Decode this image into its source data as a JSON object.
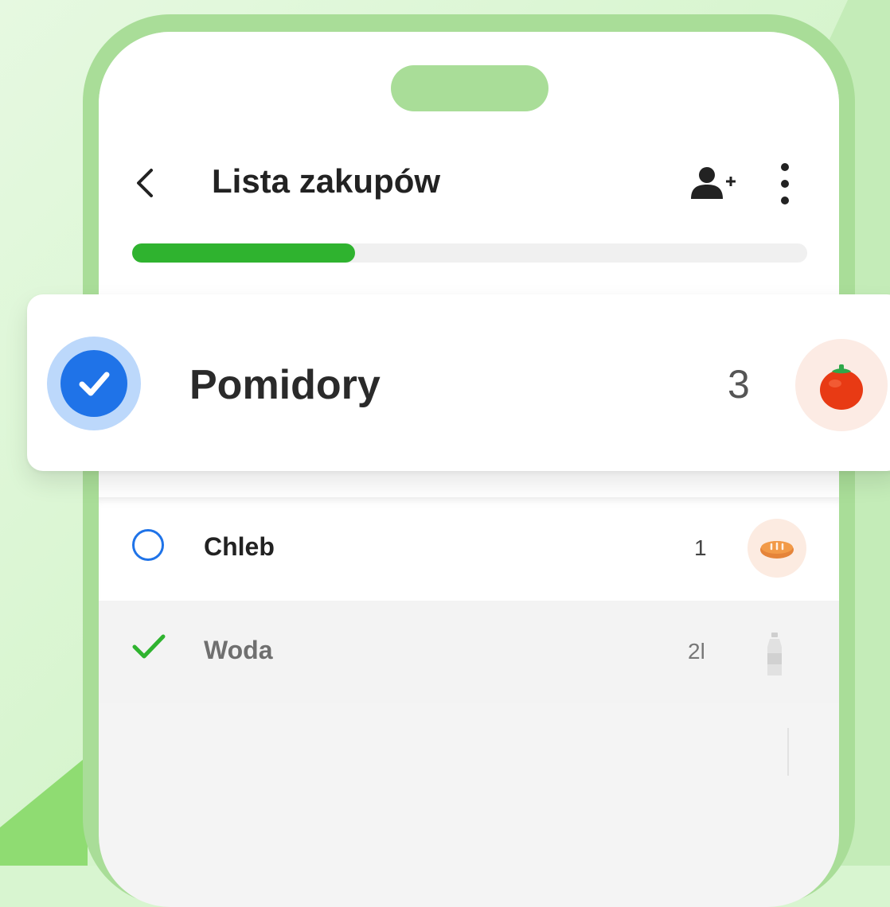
{
  "header": {
    "title": "Lista zakupów"
  },
  "progress": {
    "fraction": 0.33
  },
  "items": [
    {
      "label": "Pomidory",
      "quantity": "3",
      "state": "selected",
      "icon": "tomato-icon"
    },
    {
      "label": "Chleb",
      "quantity": "1",
      "state": "unchecked",
      "icon": "bread-icon"
    },
    {
      "label": "Woda",
      "quantity": "2l",
      "state": "checked",
      "icon": "bottle-icon"
    }
  ],
  "colors": {
    "accent_blue": "#1f73e8",
    "progress_green": "#2fb32f",
    "check_green": "#2fb32f",
    "background_green": "#d5f4cc",
    "phone_frame": "#a9dd98"
  }
}
